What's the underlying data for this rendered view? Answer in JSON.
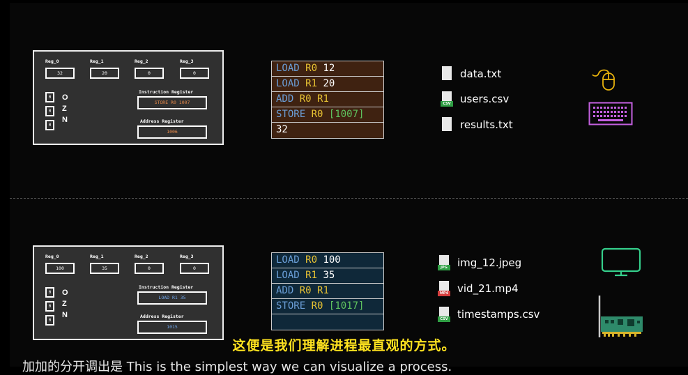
{
  "top_panel": {
    "registers": [
      {
        "label": "Reg_0",
        "value": "32"
      },
      {
        "label": "Reg_1",
        "value": "20"
      },
      {
        "label": "Reg_2",
        "value": "0"
      },
      {
        "label": "Reg_3",
        "value": "0"
      }
    ],
    "flags": [
      {
        "value": "0",
        "label": "O"
      },
      {
        "value": "0",
        "label": "Z"
      },
      {
        "value": "0",
        "label": "N"
      }
    ],
    "instruction_register_label": "Instruction Register",
    "instruction_register_value": "STORE R0 1007",
    "address_register_label": "Address Register",
    "address_register_value": "1006",
    "value_color": "#e88a4a",
    "instructions": [
      {
        "op": "LOAD",
        "reg": "R0",
        "arg": "12"
      },
      {
        "op": "LOAD",
        "reg": "R1",
        "arg": "20"
      },
      {
        "op": "ADD",
        "reg": "R0",
        "arg": "R1"
      },
      {
        "op": "STORE",
        "reg": "R0",
        "arg": "[1007]"
      },
      {
        "op": "",
        "reg": "",
        "arg": "32"
      }
    ],
    "list_color": "#3f2211",
    "files": [
      {
        "name": "data.txt",
        "icon": "text-file-icon"
      },
      {
        "name": "users.csv",
        "icon": "csv-file-icon",
        "tag": "CSV"
      },
      {
        "name": "results.txt",
        "icon": "text-file-icon"
      }
    ],
    "devices": [
      "mouse-icon",
      "keyboard-icon"
    ]
  },
  "bottom_panel": {
    "registers": [
      {
        "label": "Reg_0",
        "value": "100"
      },
      {
        "label": "Reg_1",
        "value": "35"
      },
      {
        "label": "Reg_2",
        "value": "0"
      },
      {
        "label": "Reg_3",
        "value": "0"
      }
    ],
    "flags": [
      {
        "value": "0",
        "label": "O"
      },
      {
        "value": "0",
        "label": "Z"
      },
      {
        "value": "0",
        "label": "N"
      }
    ],
    "instruction_register_label": "Instruction Register",
    "instruction_register_value": "LOAD R1 35",
    "address_register_label": "Address Register",
    "address_register_value": "1015",
    "value_color": "#6fa4e8",
    "instructions": [
      {
        "op": "LOAD",
        "reg": "R0",
        "arg": "100"
      },
      {
        "op": "LOAD",
        "reg": "R1",
        "arg": "35"
      },
      {
        "op": "ADD",
        "reg": "R0",
        "arg": "R1"
      },
      {
        "op": "STORE",
        "reg": "R0",
        "arg": "[1017]"
      },
      {
        "op": "",
        "reg": "",
        "arg": ""
      }
    ],
    "list_color": "#0f2839",
    "files": [
      {
        "name": "img_12.jpeg",
        "icon": "image-file-icon",
        "tag": "JPG"
      },
      {
        "name": "vid_21.mp4",
        "icon": "video-file-icon",
        "tag": "MP4"
      },
      {
        "name": "timestamps.csv",
        "icon": "csv-file-icon",
        "tag": "CSV"
      }
    ],
    "devices": [
      "monitor-icon",
      "network-card-icon"
    ]
  },
  "subtitles": {
    "chinese": "这便是我们理解进程最直观的方式。",
    "bottom_line": "加加的分开调出是 This is the simplest way we can visualize a process."
  }
}
